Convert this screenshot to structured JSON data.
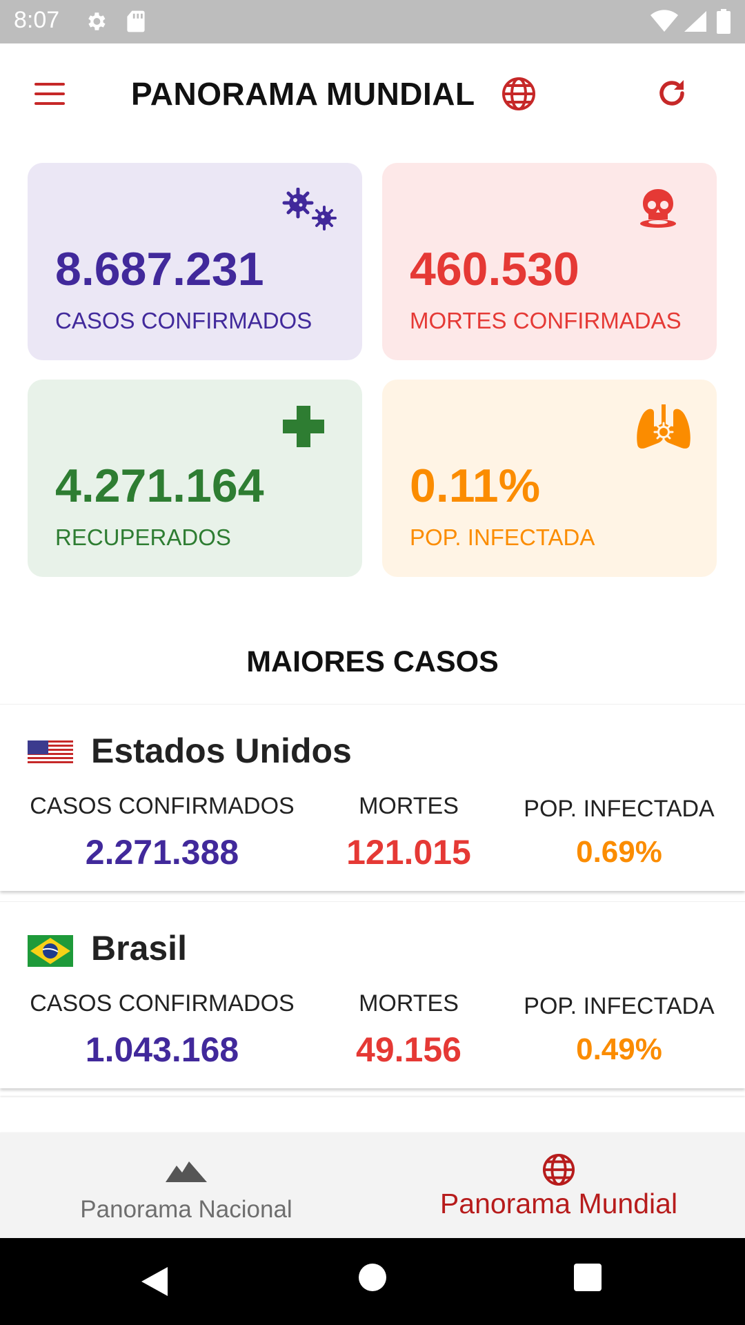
{
  "status_bar": {
    "time": "8:07"
  },
  "app_bar": {
    "title": "PANORAMA MUNDIAL"
  },
  "stats": [
    {
      "value": "8.687.231",
      "label": "CASOS CONFIRMADOS",
      "icon": "virus-icon",
      "color": "#41299b"
    },
    {
      "value": "460.530",
      "label": "MORTES CONFIRMADAS",
      "icon": "skull-icon",
      "color": "#e53935"
    },
    {
      "value": "4.271.164",
      "label": "RECUPERADOS",
      "icon": "plus-icon",
      "color": "#2e7d32"
    },
    {
      "value": "0.11%",
      "label": "POP. INFECTADA",
      "icon": "lungs-icon",
      "color": "#fb8c00"
    }
  ],
  "section_title": "MAIORES CASOS",
  "countries": [
    {
      "name": "Estados Unidos",
      "flag": "us-flag-icon",
      "cases_label": "CASOS CONFIRMADOS",
      "cases": "2.271.388",
      "deaths_label": "MORTES",
      "deaths": "121.015",
      "infected_label": "POP. INFECTADA",
      "infected": "0.69%"
    },
    {
      "name": "Brasil",
      "flag": "brazil-flag-icon",
      "cases_label": "CASOS CONFIRMADOS",
      "cases": "1.043.168",
      "deaths_label": "MORTES",
      "deaths": "49.156",
      "infected_label": "POP. INFECTADA",
      "infected": "0.49%"
    }
  ],
  "bottom_nav": {
    "tabs": [
      {
        "label": "Panorama Nacional",
        "icon": "mountain-icon",
        "active": false
      },
      {
        "label": "Panorama Mundial",
        "icon": "globe-icon",
        "active": true
      }
    ]
  },
  "colors": {
    "accent": "#c62828",
    "purple": "#41299b",
    "red": "#e53935",
    "green": "#2e7d32",
    "orange": "#fb8c00"
  }
}
